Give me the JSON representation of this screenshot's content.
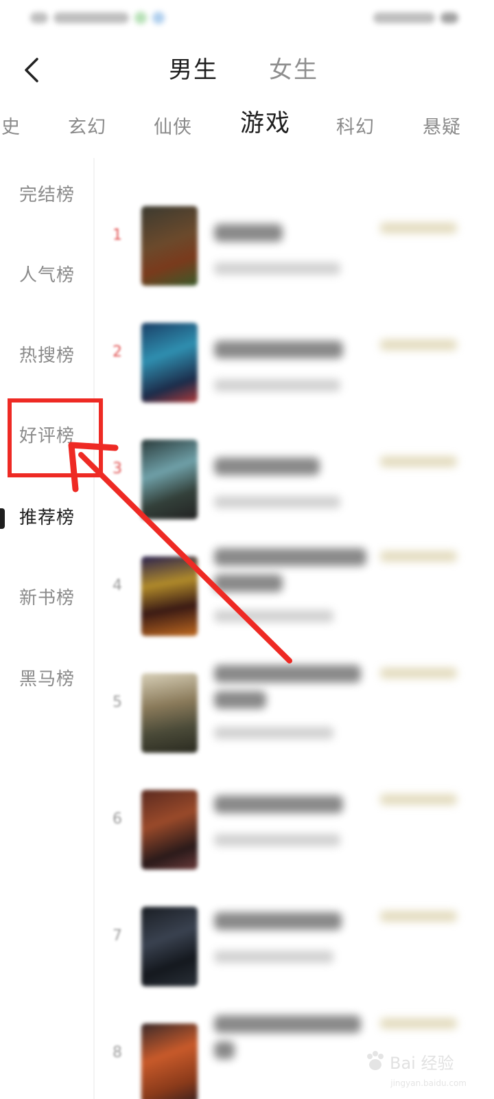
{
  "header": {
    "back_icon": "chevron-left-icon",
    "tabs": [
      {
        "label": "男生",
        "active": true
      },
      {
        "label": "女生",
        "active": false
      }
    ]
  },
  "category_tabs": [
    {
      "label": "史",
      "active": false
    },
    {
      "label": "玄幻",
      "active": false
    },
    {
      "label": "仙侠",
      "active": false
    },
    {
      "label": "游戏",
      "active": true
    },
    {
      "label": "科幻",
      "active": false
    },
    {
      "label": "悬疑",
      "active": false
    }
  ],
  "sidebar": {
    "items": [
      {
        "label": "完结榜",
        "active": false
      },
      {
        "label": "人气榜",
        "active": false
      },
      {
        "label": "热搜榜",
        "active": false
      },
      {
        "label": "好评榜",
        "active": false,
        "highlighted": true
      },
      {
        "label": "推荐榜",
        "active": true
      },
      {
        "label": "新书榜",
        "active": false
      },
      {
        "label": "黑马榜",
        "active": false
      }
    ]
  },
  "book_list": [
    {
      "rank": "1",
      "top": true
    },
    {
      "rank": "2",
      "top": true
    },
    {
      "rank": "3",
      "top": true
    },
    {
      "rank": "4",
      "top": false
    },
    {
      "rank": "5",
      "top": false
    },
    {
      "rank": "6",
      "top": false
    },
    {
      "rank": "7",
      "top": false
    },
    {
      "rank": "8",
      "top": false
    }
  ],
  "annotation": {
    "color": "#ee2a24",
    "target": "好评榜"
  },
  "colors": {
    "accent_red": "#ee2a24",
    "active_text": "#1e1e1e",
    "inactive_text": "#8a8a8a",
    "rank_red": "#e05050"
  },
  "watermark": {
    "logo_icon": "paw-icon",
    "text": "Bai 经验",
    "subtext": "jingyan.baidu.com"
  }
}
